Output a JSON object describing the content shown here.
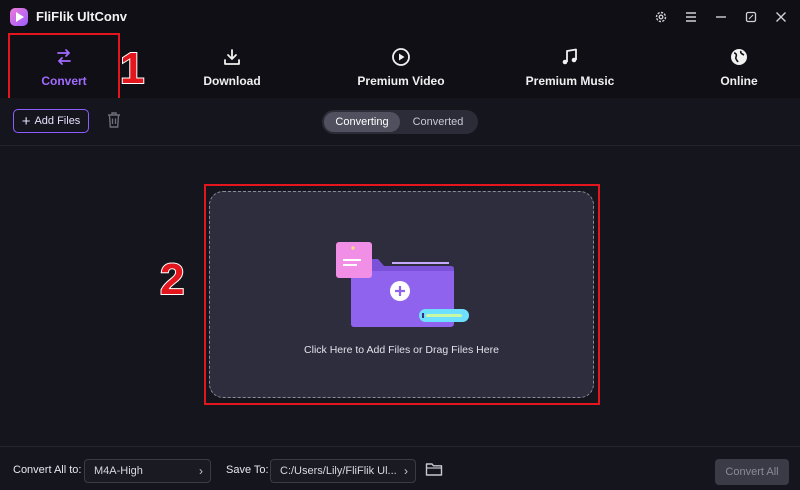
{
  "app": {
    "title": "FliFlik UltConv"
  },
  "window_controls": [
    {
      "icon": "gear-icon"
    },
    {
      "icon": "menu-icon"
    },
    {
      "icon": "minimize-icon"
    },
    {
      "icon": "maximize-icon"
    },
    {
      "icon": "close-icon"
    }
  ],
  "nav": {
    "items": [
      {
        "label": "Convert",
        "icon": "convert-arrows-icon",
        "active": true
      },
      {
        "label": "Download",
        "icon": "download-icon",
        "active": false
      },
      {
        "label": "Premium Video",
        "icon": "play-circle-icon",
        "active": false
      },
      {
        "label": "Premium Music",
        "icon": "music-note-icon",
        "active": false
      },
      {
        "label": "Online",
        "icon": "globe-icon",
        "active": false
      }
    ]
  },
  "annotations": {
    "first": "1",
    "second": "2"
  },
  "toolbar": {
    "add_files_label": "Add Files",
    "tabs": [
      {
        "label": "Converting",
        "active": true
      },
      {
        "label": "Converted",
        "active": false
      }
    ]
  },
  "dropzone": {
    "hint": "Click Here to Add Files or Drag Files Here"
  },
  "footer": {
    "convert_all_to_label": "Convert All to:",
    "format_value": "M4A-High",
    "save_to_label": "Save To:",
    "save_path": "C:/Users/Lily/FliFlik Ul...",
    "convert_all_button": "Convert All"
  },
  "colors": {
    "accent": "#a26bff",
    "annotation": "#e3151d",
    "background": "#15151d"
  }
}
